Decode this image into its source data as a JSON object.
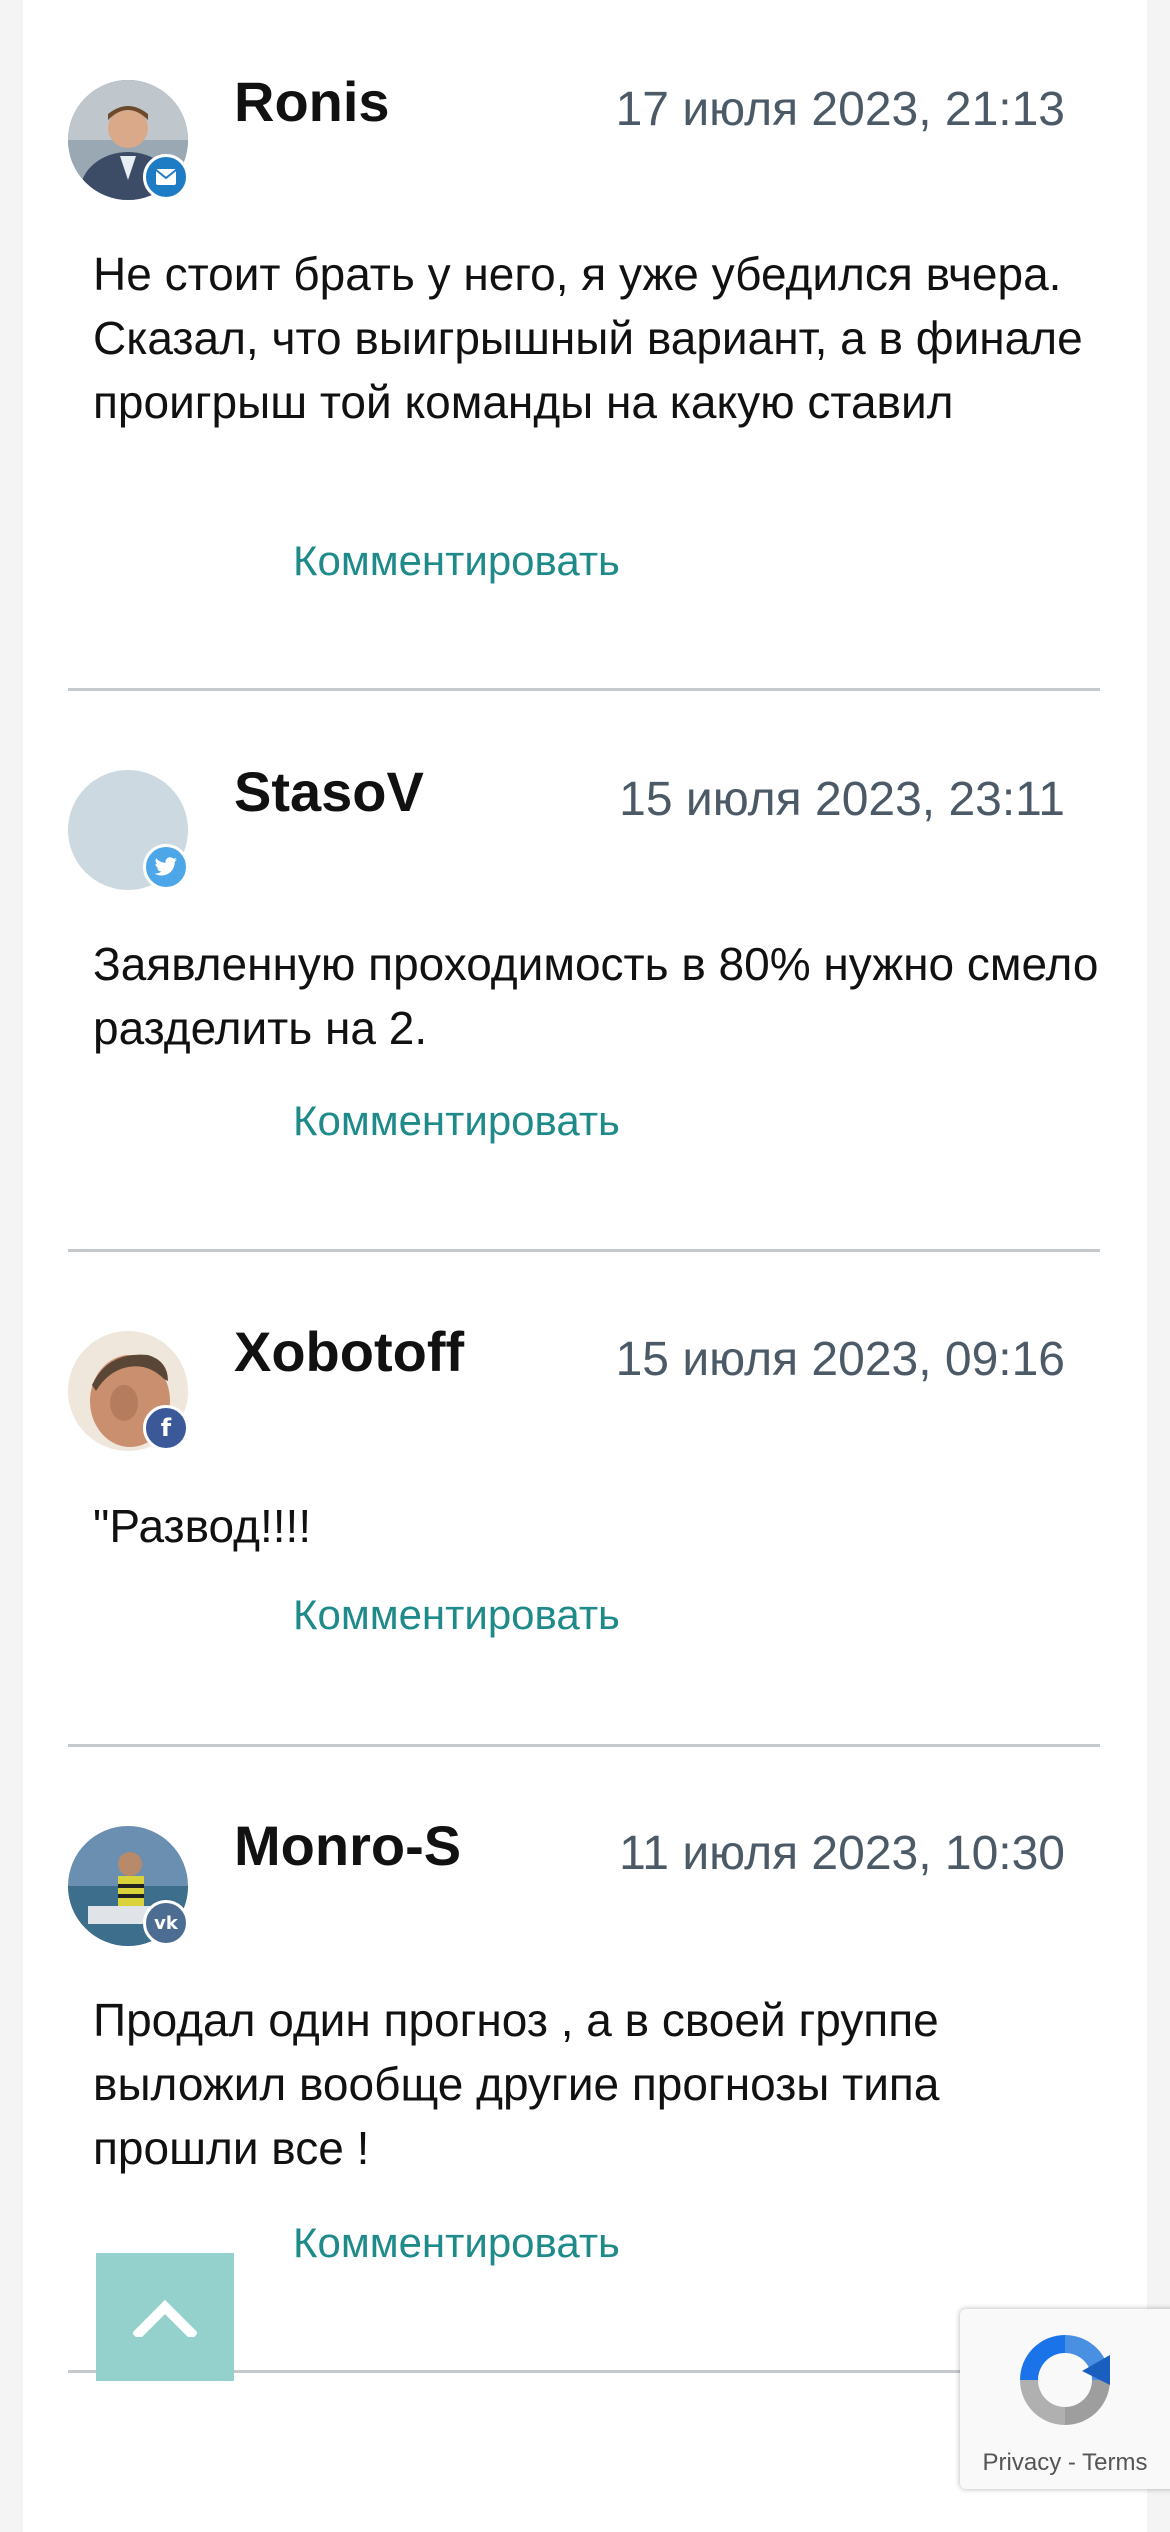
{
  "comments": [
    {
      "username": "Ronis",
      "date": "17 июля 2023, 21:13",
      "text": "Не стоит брать у него, я уже убедился вчера. Сказал, что выигрышный вариант, а в финале проигрыш той команды на какую ставил",
      "reply_label": "Комментировать",
      "badge_icon": "mail-icon",
      "badge_color": "#1e7cc5"
    },
    {
      "username": "StasoV",
      "date": "15 июля 2023, 23:11",
      "text": "Заявленную проходимость в 80% нужно смело разделить на 2.",
      "reply_label": "Комментировать",
      "badge_icon": "twitter-icon",
      "badge_color": "#4da6e8"
    },
    {
      "username": "Xobotoff",
      "date": "15 июля 2023, 09:16",
      "text": "\"Развод!!!!",
      "reply_label": "Комментировать",
      "badge_icon": "facebook-icon",
      "badge_color": "#3b5998"
    },
    {
      "username": "Monro-S",
      "date": "11 июля 2023, 10:30",
      "text": "Продал один прогноз , а в своей группе выложил вообще другие прогнозы типа прошли все !",
      "reply_label": "Комментировать",
      "badge_icon": "vk-icon",
      "badge_color": "#4c6c91"
    }
  ],
  "recaptcha": {
    "privacy": "Privacy",
    "separator": "-",
    "terms": "Terms"
  },
  "colors": {
    "accent": "#1f8a8a",
    "scroll_button": "#94d1cd"
  }
}
